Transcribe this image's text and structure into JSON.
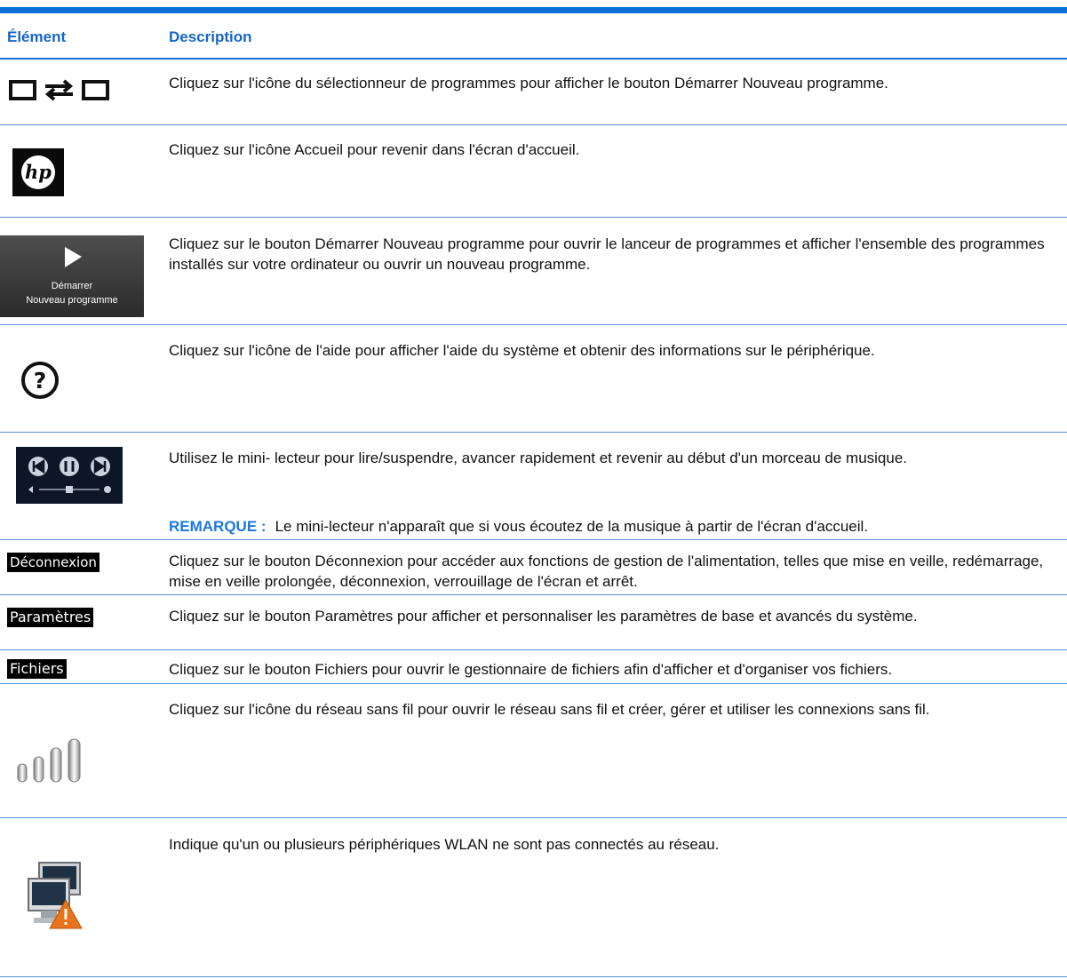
{
  "table": {
    "headers": {
      "element": "Élément",
      "description": "Description"
    },
    "rows": [
      {
        "icon": "program-switcher-icon",
        "description": "Cliquez sur l'icône du sélectionneur de programmes pour afficher le bouton Démarrer Nouveau programme."
      },
      {
        "icon": "hp-home-icon",
        "description": "Cliquez sur l'icône Accueil pour revenir dans l'écran d'accueil."
      },
      {
        "icon": "start-new-program-button-image",
        "icon_text": [
          "Démarrer",
          "Nouveau programme"
        ],
        "description": "Cliquez sur le bouton Démarrer Nouveau programme pour ouvrir le lanceur de programmes et afficher l'ensemble des programmes installés sur votre ordinateur ou ouvrir un nouveau programme."
      },
      {
        "icon": "help-icon",
        "description": "Cliquez sur l'icône de l'aide pour afficher l'aide du système et obtenir des informations sur le périphérique."
      },
      {
        "icon": "mini-player-icon",
        "description": "Utilisez le mini- lecteur pour lire/suspendre, avancer rapidement et revenir au début d'un morceau de musique.",
        "note_label": "REMARQUE :",
        "note_text": "Le mini-lecteur n'apparaît que si vous écoutez de la musique à partir de l'écran d'accueil."
      },
      {
        "icon": "logout-button-image",
        "icon_text": "Déconnexion",
        "description": "Cliquez sur le bouton Déconnexion pour accéder aux fonctions de gestion de l'alimentation, telles que mise en veille, redémarrage, mise en veille prolongée, déconnexion, verrouillage de l'écran et arrêt."
      },
      {
        "icon": "settings-button-image",
        "icon_text": "Paramètres",
        "description": "Cliquez sur le bouton Paramètres pour afficher et personnaliser les paramètres de base et avancés du système."
      },
      {
        "icon": "files-button-image",
        "icon_text": "Fichiers",
        "description": "Cliquez sur le bouton Fichiers pour ouvrir le gestionnaire de fichiers afin d'afficher et d'organiser vos fichiers."
      },
      {
        "icon": "wireless-signal-icon",
        "description": "Cliquez sur l'icône du réseau sans fil pour ouvrir le réseau sans fil et créer, gérer et utiliser les connexions sans fil."
      },
      {
        "icon": "wlan-disconnected-icon",
        "description": "Indique qu'un ou plusieurs périphériques WLAN ne sont pas connectés au réseau."
      }
    ]
  },
  "colors": {
    "accent": "#1466c6",
    "rule": "#5b8fd0",
    "note": "#1a78e0"
  }
}
